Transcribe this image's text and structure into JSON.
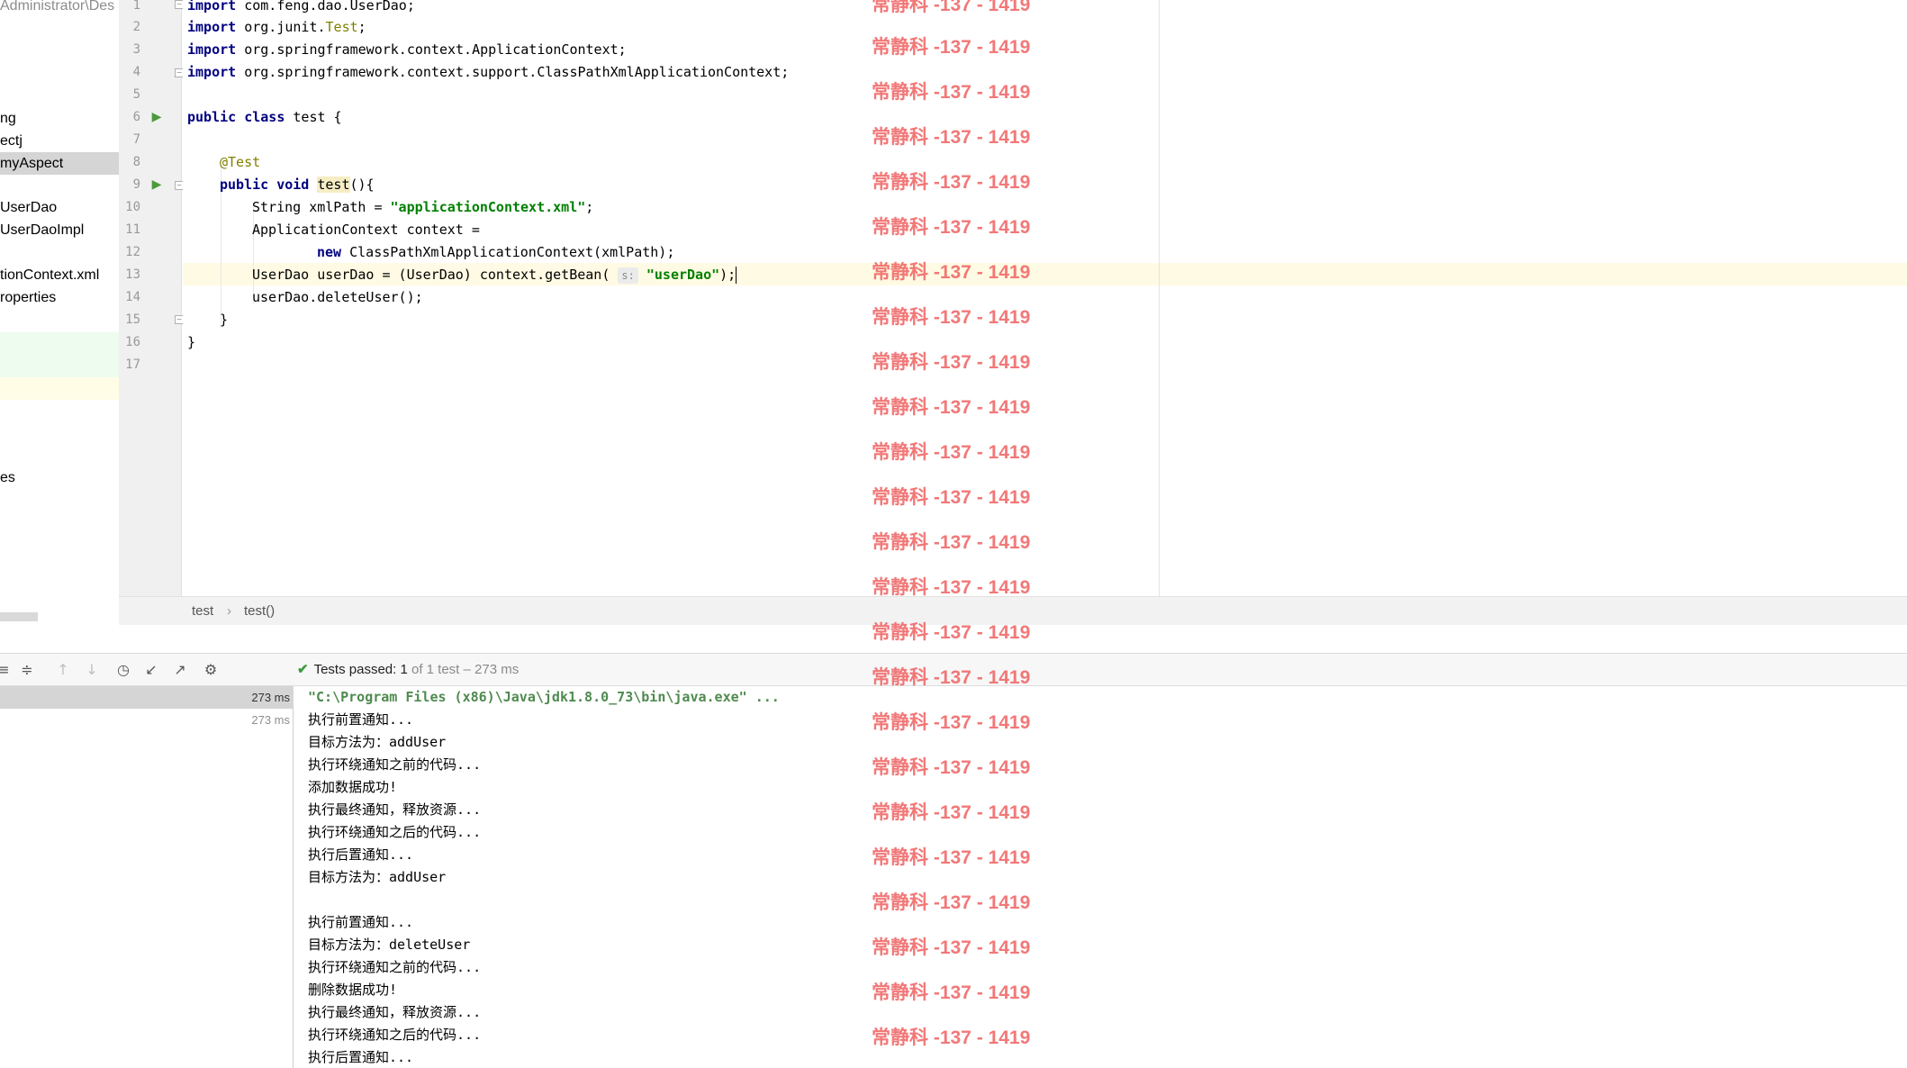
{
  "project_tree": {
    "path_label": "Administrator\\Des",
    "items": [
      "ng",
      "ectj",
      "myAspect",
      "UserDao",
      "UserDaoImpl",
      "tionContext.xml",
      "roperties",
      "es"
    ],
    "selected": "myAspect"
  },
  "editor": {
    "line_numbers": [
      "1",
      "2",
      "3",
      "4",
      "5",
      "6",
      "7",
      "8",
      "9",
      "10",
      "11",
      "12",
      "13",
      "14",
      "15",
      "16",
      "17"
    ],
    "code": {
      "l1_kw": "import",
      "l1_rest": " com.feng.dao.UserDao;",
      "l2_kw": "import",
      "l2_mid": " org.junit.",
      "l2_cls": "Test",
      "l2_end": ";",
      "l3_kw": "import",
      "l3_rest": " org.springframework.context.ApplicationContext;",
      "l4_kw": "import",
      "l4_rest": " org.springframework.context.support.ClassPathXmlApplicationContext;",
      "l6_kw1": "public",
      "l6_kw2": "class",
      "l6_rest": " test {",
      "l8_ann": "@Test",
      "l9_kw1": "public",
      "l9_kw2": "void",
      "l9_method": "test",
      "l9_rest": "(){",
      "l10_pre": "String xmlPath = ",
      "l10_str": "\"applicationContext.xml\"",
      "l10_end": ";",
      "l11": "ApplicationContext context =",
      "l12_kw": "new",
      "l12_rest": " ClassPathXmlApplicationContext(xmlPath);",
      "l13_pre": "UserDao userDao = (UserDao) context.getBean( ",
      "l13_hint": "s:",
      "l13_str": "\"userDao\"",
      "l13_end": ");",
      "l14": "userDao.deleteUser();",
      "l15": "}",
      "l16": "}"
    }
  },
  "breadcrumb": {
    "class_name": "test",
    "separator": "›",
    "method_name": "test()"
  },
  "run_toolbar": {
    "icons": [
      "collapse-all-icon",
      "expand-all-icon",
      "previous-test-icon",
      "next-test-icon",
      "history-icon",
      "import-tests-icon",
      "export-tests-icon",
      "settings-icon"
    ],
    "status_label": "Tests passed:",
    "passed_count": "1",
    "status_rest": "of 1 test – 273 ms",
    "status_color": "#3e9a3e"
  },
  "test_tree": {
    "rows": [
      "273 ms",
      "273 ms"
    ]
  },
  "console": {
    "command": "\"C:\\Program Files (x86)\\Java\\jdk1.8.0_73\\bin\\java.exe\" ...",
    "lines": [
      "执行前置通知...",
      "目标方法为：addUser",
      "执行环绕通知之前的代码...",
      "添加数据成功!",
      "执行最终通知，释放资源...",
      "执行环绕通知之后的代码...",
      "执行后置通知...",
      "目标方法为：addUser",
      "",
      "执行前置通知...",
      "目标方法为：deleteUser",
      "执行环绕通知之前的代码...",
      "删除数据成功!",
      "执行最终通知，释放资源...",
      "执行环绕通知之后的代码...",
      "执行后置通知..."
    ]
  },
  "watermark": {
    "text": "常静科 -137 - 1419",
    "color": "#f06060"
  }
}
